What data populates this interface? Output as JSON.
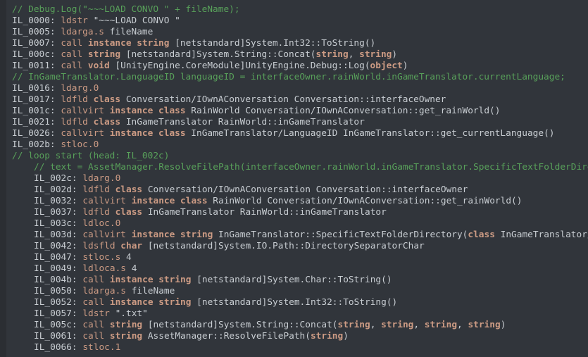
{
  "view": {
    "name": "il-disassembly",
    "background_color": "#31353b",
    "gutter_color": "#2b2e33",
    "colors": {
      "comment": "#58a05a",
      "opcode": "#cc9b84",
      "keyword": "#cc9b84",
      "identifier": "#c8cdd2",
      "string": "#c8cdd2"
    }
  },
  "lines": [
    {
      "indent": 0,
      "tokens": [
        {
          "t": "comment",
          "v": "// Debug.Log(\"~~~LOAD CONVO \" + fileName);"
        }
      ]
    },
    {
      "indent": 0,
      "tokens": [
        {
          "t": "label",
          "v": "IL_0000: "
        },
        {
          "t": "opcode",
          "v": "ldstr"
        },
        {
          "t": "plain",
          "v": " "
        },
        {
          "t": "string",
          "v": "\"~~~LOAD CONVO \""
        }
      ]
    },
    {
      "indent": 0,
      "tokens": [
        {
          "t": "label",
          "v": "IL_0005: "
        },
        {
          "t": "opcode",
          "v": "ldarga.s"
        },
        {
          "t": "plain",
          "v": " fileName"
        }
      ]
    },
    {
      "indent": 0,
      "tokens": [
        {
          "t": "label",
          "v": "IL_0007: "
        },
        {
          "t": "opcode",
          "v": "call"
        },
        {
          "t": "plain",
          "v": " "
        },
        {
          "t": "keyword",
          "v": "instance string"
        },
        {
          "t": "plain",
          "v": " [netstandard]System.Int32::ToString()"
        }
      ]
    },
    {
      "indent": 0,
      "tokens": [
        {
          "t": "label",
          "v": "IL_000c: "
        },
        {
          "t": "opcode",
          "v": "call"
        },
        {
          "t": "plain",
          "v": " "
        },
        {
          "t": "keyword",
          "v": "string"
        },
        {
          "t": "plain",
          "v": " [netstandard]System.String::Concat("
        },
        {
          "t": "keyword",
          "v": "string"
        },
        {
          "t": "plain",
          "v": ", "
        },
        {
          "t": "keyword",
          "v": "string"
        },
        {
          "t": "plain",
          "v": ")"
        }
      ]
    },
    {
      "indent": 0,
      "tokens": [
        {
          "t": "label",
          "v": "IL_0011: "
        },
        {
          "t": "opcode",
          "v": "call"
        },
        {
          "t": "plain",
          "v": " "
        },
        {
          "t": "keyword",
          "v": "void"
        },
        {
          "t": "plain",
          "v": " [UnityEngine.CoreModule]UnityEngine.Debug::Log("
        },
        {
          "t": "keyword",
          "v": "object"
        },
        {
          "t": "plain",
          "v": ")"
        }
      ]
    },
    {
      "indent": 0,
      "tokens": [
        {
          "t": "comment",
          "v": "// InGameTranslator.LanguageID languageID = interfaceOwner.rainWorld.inGameTranslator.currentLanguage;"
        }
      ]
    },
    {
      "indent": 0,
      "tokens": [
        {
          "t": "label",
          "v": "IL_0016: "
        },
        {
          "t": "opcode",
          "v": "ldarg.0"
        }
      ]
    },
    {
      "indent": 0,
      "tokens": [
        {
          "t": "label",
          "v": "IL_0017: "
        },
        {
          "t": "opcode",
          "v": "ldfld"
        },
        {
          "t": "plain",
          "v": " "
        },
        {
          "t": "keyword",
          "v": "class"
        },
        {
          "t": "plain",
          "v": " Conversation/IOwnAConversation Conversation::interfaceOwner"
        }
      ]
    },
    {
      "indent": 0,
      "tokens": [
        {
          "t": "label",
          "v": "IL_001c: "
        },
        {
          "t": "opcode",
          "v": "callvirt"
        },
        {
          "t": "plain",
          "v": " "
        },
        {
          "t": "keyword",
          "v": "instance class"
        },
        {
          "t": "plain",
          "v": " RainWorld Conversation/IOwnAConversation::get_rainWorld()"
        }
      ]
    },
    {
      "indent": 0,
      "tokens": [
        {
          "t": "label",
          "v": "IL_0021: "
        },
        {
          "t": "opcode",
          "v": "ldfld"
        },
        {
          "t": "plain",
          "v": " "
        },
        {
          "t": "keyword",
          "v": "class"
        },
        {
          "t": "plain",
          "v": " InGameTranslator RainWorld::inGameTranslator"
        }
      ]
    },
    {
      "indent": 0,
      "tokens": [
        {
          "t": "label",
          "v": "IL_0026: "
        },
        {
          "t": "opcode",
          "v": "callvirt"
        },
        {
          "t": "plain",
          "v": " "
        },
        {
          "t": "keyword",
          "v": "instance class"
        },
        {
          "t": "plain",
          "v": " InGameTranslator/LanguageID InGameTranslator::get_currentLanguage()"
        }
      ]
    },
    {
      "indent": 0,
      "tokens": [
        {
          "t": "label",
          "v": "IL_002b: "
        },
        {
          "t": "opcode",
          "v": "stloc.0"
        }
      ]
    },
    {
      "indent": 0,
      "tokens": [
        {
          "t": "comment",
          "v": "// loop start (head: IL_002c)"
        }
      ]
    },
    {
      "indent": 1,
      "tokens": [
        {
          "t": "comment",
          "v": "// text = AssetManager.ResolveFilePath(interfaceOwner.rainWorld.inGameTranslator.SpecificTextFolderDirectory(languageID) + Path.DirectorySeparatorChar.ToString() + fileName.ToString() + \".txt\");"
        }
      ]
    },
    {
      "indent": 1,
      "tokens": [
        {
          "t": "label",
          "v": "IL_002c: "
        },
        {
          "t": "opcode",
          "v": "ldarg.0"
        }
      ]
    },
    {
      "indent": 1,
      "tokens": [
        {
          "t": "label",
          "v": "IL_002d: "
        },
        {
          "t": "opcode",
          "v": "ldfld"
        },
        {
          "t": "plain",
          "v": " "
        },
        {
          "t": "keyword",
          "v": "class"
        },
        {
          "t": "plain",
          "v": " Conversation/IOwnAConversation Conversation::interfaceOwner"
        }
      ]
    },
    {
      "indent": 1,
      "tokens": [
        {
          "t": "label",
          "v": "IL_0032: "
        },
        {
          "t": "opcode",
          "v": "callvirt"
        },
        {
          "t": "plain",
          "v": " "
        },
        {
          "t": "keyword",
          "v": "instance class"
        },
        {
          "t": "plain",
          "v": " RainWorld Conversation/IOwnAConversation::get_rainWorld()"
        }
      ]
    },
    {
      "indent": 1,
      "tokens": [
        {
          "t": "label",
          "v": "IL_0037: "
        },
        {
          "t": "opcode",
          "v": "ldfld"
        },
        {
          "t": "plain",
          "v": " "
        },
        {
          "t": "keyword",
          "v": "class"
        },
        {
          "t": "plain",
          "v": " InGameTranslator RainWorld::inGameTranslator"
        }
      ]
    },
    {
      "indent": 1,
      "tokens": [
        {
          "t": "label",
          "v": "IL_003c: "
        },
        {
          "t": "opcode",
          "v": "ldloc.0"
        }
      ]
    },
    {
      "indent": 1,
      "tokens": [
        {
          "t": "label",
          "v": "IL_003d: "
        },
        {
          "t": "opcode",
          "v": "callvirt"
        },
        {
          "t": "plain",
          "v": " "
        },
        {
          "t": "keyword",
          "v": "instance string"
        },
        {
          "t": "plain",
          "v": " InGameTranslator::SpecificTextFolderDirectory("
        },
        {
          "t": "keyword",
          "v": "class"
        },
        {
          "t": "plain",
          "v": " InGameTranslator/LanguageID)"
        }
      ]
    },
    {
      "indent": 1,
      "tokens": [
        {
          "t": "label",
          "v": "IL_0042: "
        },
        {
          "t": "opcode",
          "v": "ldsfld"
        },
        {
          "t": "plain",
          "v": " "
        },
        {
          "t": "keyword",
          "v": "char"
        },
        {
          "t": "plain",
          "v": " [netstandard]System.IO.Path::DirectorySeparatorChar"
        }
      ]
    },
    {
      "indent": 1,
      "tokens": [
        {
          "t": "label",
          "v": "IL_0047: "
        },
        {
          "t": "opcode",
          "v": "stloc.s"
        },
        {
          "t": "plain",
          "v": " 4"
        }
      ]
    },
    {
      "indent": 1,
      "tokens": [
        {
          "t": "label",
          "v": "IL_0049: "
        },
        {
          "t": "opcode",
          "v": "ldloca.s"
        },
        {
          "t": "plain",
          "v": " 4"
        }
      ]
    },
    {
      "indent": 1,
      "tokens": [
        {
          "t": "label",
          "v": "IL_004b: "
        },
        {
          "t": "opcode",
          "v": "call"
        },
        {
          "t": "plain",
          "v": " "
        },
        {
          "t": "keyword",
          "v": "instance string"
        },
        {
          "t": "plain",
          "v": " [netstandard]System.Char::ToString()"
        }
      ]
    },
    {
      "indent": 1,
      "tokens": [
        {
          "t": "label",
          "v": "IL_0050: "
        },
        {
          "t": "opcode",
          "v": "ldarga.s"
        },
        {
          "t": "plain",
          "v": " fileName"
        }
      ]
    },
    {
      "indent": 1,
      "tokens": [
        {
          "t": "label",
          "v": "IL_0052: "
        },
        {
          "t": "opcode",
          "v": "call"
        },
        {
          "t": "plain",
          "v": " "
        },
        {
          "t": "keyword",
          "v": "instance string"
        },
        {
          "t": "plain",
          "v": " [netstandard]System.Int32::ToString()"
        }
      ]
    },
    {
      "indent": 1,
      "tokens": [
        {
          "t": "label",
          "v": "IL_0057: "
        },
        {
          "t": "opcode",
          "v": "ldstr"
        },
        {
          "t": "plain",
          "v": " "
        },
        {
          "t": "string",
          "v": "\".txt\""
        }
      ]
    },
    {
      "indent": 1,
      "tokens": [
        {
          "t": "label",
          "v": "IL_005c: "
        },
        {
          "t": "opcode",
          "v": "call"
        },
        {
          "t": "plain",
          "v": " "
        },
        {
          "t": "keyword",
          "v": "string"
        },
        {
          "t": "plain",
          "v": " [netstandard]System.String::Concat("
        },
        {
          "t": "keyword",
          "v": "string"
        },
        {
          "t": "plain",
          "v": ", "
        },
        {
          "t": "keyword",
          "v": "string"
        },
        {
          "t": "plain",
          "v": ", "
        },
        {
          "t": "keyword",
          "v": "string"
        },
        {
          "t": "plain",
          "v": ", "
        },
        {
          "t": "keyword",
          "v": "string"
        },
        {
          "t": "plain",
          "v": ")"
        }
      ]
    },
    {
      "indent": 1,
      "tokens": [
        {
          "t": "label",
          "v": "IL_0061: "
        },
        {
          "t": "opcode",
          "v": "call"
        },
        {
          "t": "plain",
          "v": " "
        },
        {
          "t": "keyword",
          "v": "string"
        },
        {
          "t": "plain",
          "v": " AssetManager::ResolveFilePath("
        },
        {
          "t": "keyword",
          "v": "string"
        },
        {
          "t": "plain",
          "v": ")"
        }
      ]
    },
    {
      "indent": 1,
      "tokens": [
        {
          "t": "label",
          "v": "IL_0066: "
        },
        {
          "t": "opcode",
          "v": "stloc.1"
        }
      ]
    }
  ]
}
